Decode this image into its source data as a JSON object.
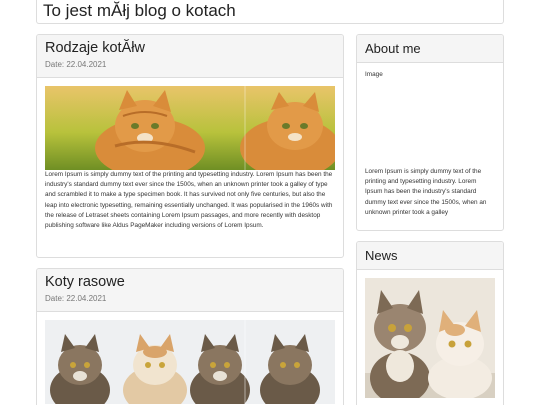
{
  "header": {
    "title": "To jest mĂłj blog o kotach"
  },
  "posts": [
    {
      "title": "Rodzaje kotĂłw",
      "date": "Date: 22.04.2021",
      "image_desc": "orange-tabby-cat-in-grass",
      "text": "Lorem Ipsum is simply dummy text of the printing and typesetting industry. Lorem Ipsum has been the industry's standard dummy text ever since the 1500s, when an unknown printer took a galley of type and scrambled it to make a type specimen book. It has survived not only five centuries, but also the leap into electronic typesetting, remaining essentially unchanged. It was popularised in the 1960s with the release of Letraset sheets containing Lorem Ipsum passages, and more recently with desktop publishing software like Aldus PageMaker including versions of Lorem Ipsum."
    },
    {
      "title": "Koty rasowe",
      "date": "Date: 22.04.2021",
      "image_desc": "maine-coon-cats-group"
    }
  ],
  "about": {
    "title": "About me",
    "image_label": "Image",
    "text": "Lorem Ipsum is simply dummy text of the printing and typesetting industry. Lorem Ipsum has been the industry's standard dummy text ever since the 1500s, when an unknown printer took a galley"
  },
  "news": {
    "title": "News",
    "image_desc": "tabby-and-white-kittens"
  },
  "colors": {
    "panel_head": "#f5f5f5",
    "border": "#dddddd",
    "text": "#333333"
  }
}
